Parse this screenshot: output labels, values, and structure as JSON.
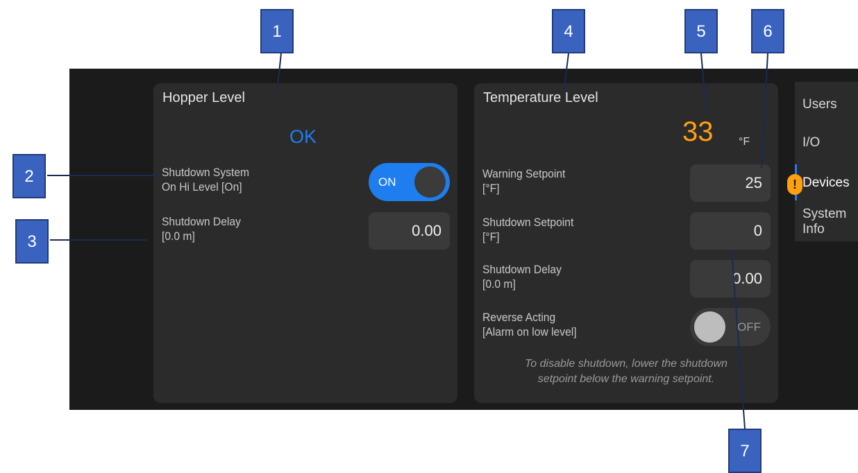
{
  "callouts": [
    "1",
    "2",
    "3",
    "4",
    "5",
    "6",
    "7"
  ],
  "hopper": {
    "title": "Hopper Level",
    "status": "OK",
    "shutdown_system_label_1": "Shutdown System",
    "shutdown_system_label_2": "On Hi Level [On]",
    "shutdown_system_toggle": "ON",
    "shutdown_delay_label_1": "Shutdown Delay",
    "shutdown_delay_label_2": "[0.0 m]",
    "shutdown_delay_value": "0.00"
  },
  "temperature": {
    "title": "Temperature Level",
    "reading": "33",
    "unit": "°F",
    "warning_label_1": "Warning Setpoint",
    "warning_label_2": "[°F]",
    "warning_value": "25",
    "shutdown_setpoint_label_1": "Shutdown Setpoint",
    "shutdown_setpoint_label_2": "[°F]",
    "shutdown_setpoint_value": "0",
    "shutdown_delay_label_1": "Shutdown Delay",
    "shutdown_delay_label_2": "[0.0 m]",
    "shutdown_delay_value": "0.00",
    "reverse_label_1": "Reverse Acting",
    "reverse_label_2": "[Alarm on low level]",
    "reverse_toggle": "OFF",
    "note_1": "To disable shutdown, lower the shutdown",
    "note_2": "setpoint below the warning setpoint."
  },
  "nav": {
    "items": [
      {
        "label": "Users"
      },
      {
        "label": "I/O"
      },
      {
        "label": "Devices"
      },
      {
        "label_1": "System",
        "label_2": "Info"
      }
    ],
    "alert_glyph": "!"
  },
  "colors": {
    "accent_blue": "#1e7ef0",
    "reading_orange": "#ffa010",
    "callout_blue": "#3a63c0"
  }
}
